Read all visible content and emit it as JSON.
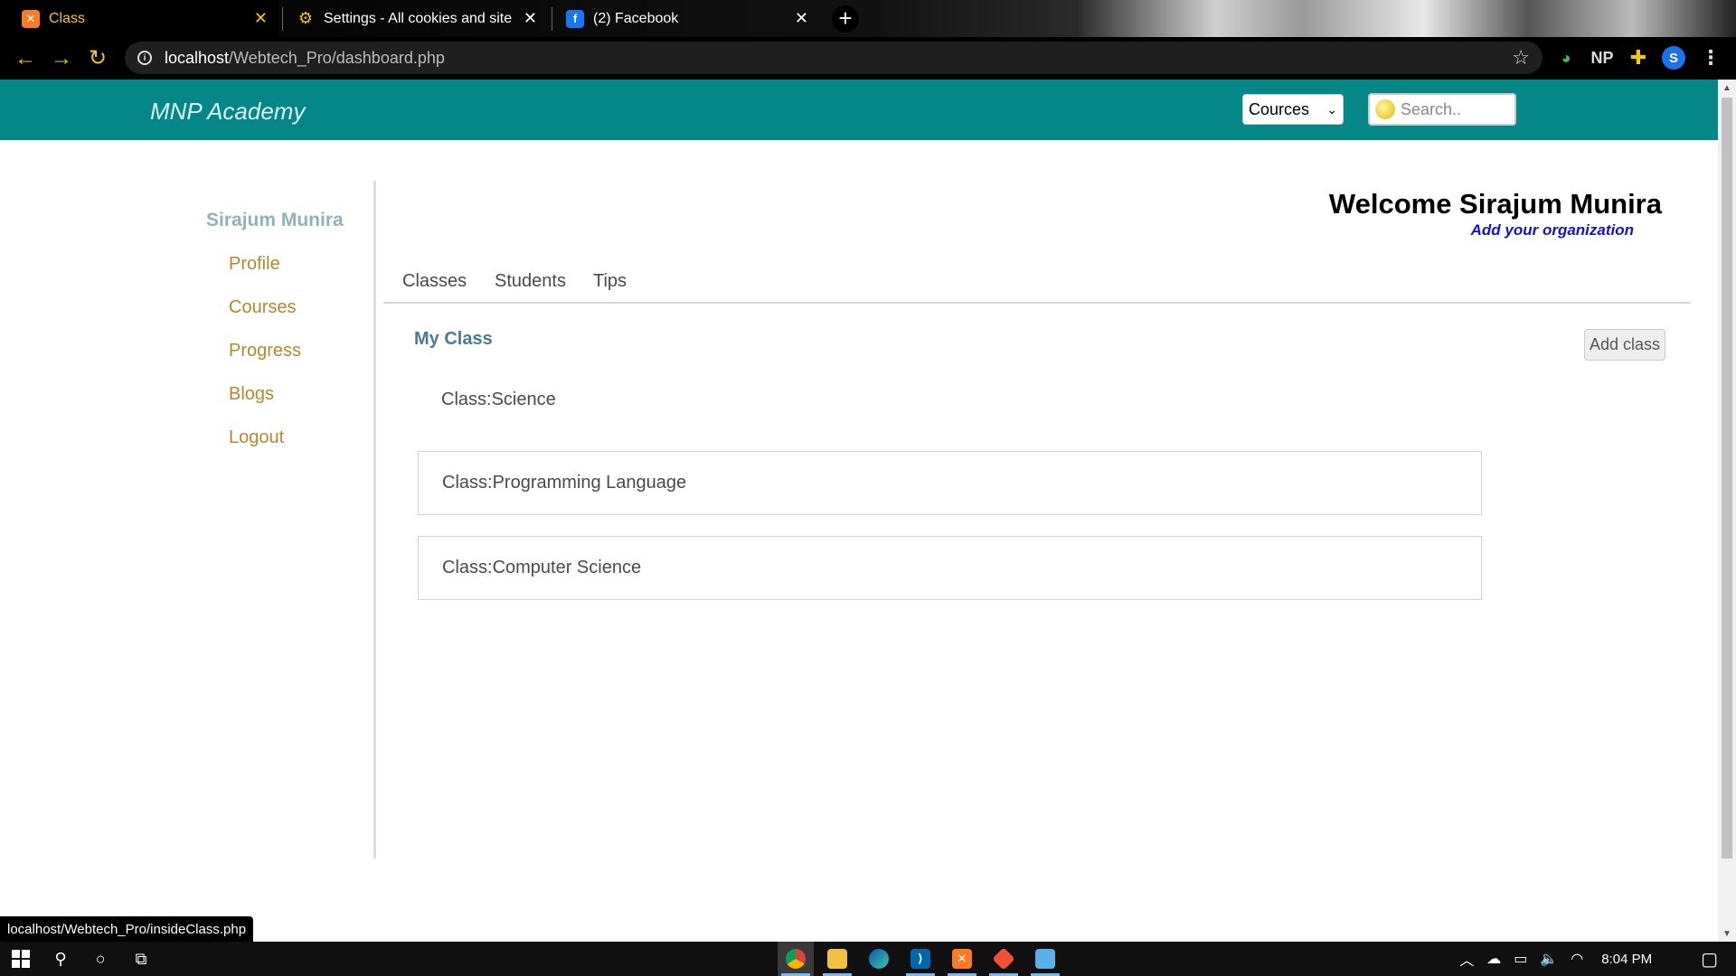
{
  "browser": {
    "tabs": [
      {
        "title": "Class",
        "favicon": "xampp-icon",
        "active": true
      },
      {
        "title": "Settings - All cookies and site data",
        "favicon": "gear-icon",
        "active": false
      },
      {
        "title": "(2) Facebook",
        "favicon": "facebook-icon",
        "active": false
      }
    ],
    "url_host": "localhost",
    "url_path": "/Webtech_Pro/dashboard.php",
    "extensions": [
      "NP"
    ],
    "profile_initial": "S",
    "status_url": "localhost/Webtech_Pro/insideClass.php"
  },
  "site": {
    "brand": "MNP Academy",
    "course_select": {
      "selected": "Cources"
    },
    "search": {
      "placeholder": "Search.."
    },
    "colors": {
      "header_bg": "#058787",
      "link": "#b8862b",
      "welcome_org": "#1410d6"
    }
  },
  "sidebar": {
    "user_name": "Sirajum Munira",
    "links": [
      {
        "label": "Profile"
      },
      {
        "label": "Courses"
      },
      {
        "label": "Progress"
      },
      {
        "label": "Blogs"
      },
      {
        "label": "Logout"
      }
    ]
  },
  "main": {
    "welcome": "Welcome Sirajum Munira",
    "organization_link": "Add your organization",
    "tabs": [
      {
        "label": "Classes"
      },
      {
        "label": "Students"
      },
      {
        "label": "Tips"
      }
    ],
    "section_title": "My Class",
    "add_class_label": "Add class",
    "classes": [
      {
        "label": "Class:Science",
        "hovered": true
      },
      {
        "label": "Class:Programming Language",
        "hovered": false
      },
      {
        "label": "Class:Computer Science",
        "hovered": false
      }
    ]
  },
  "taskbar": {
    "time": "8:04 PM"
  }
}
